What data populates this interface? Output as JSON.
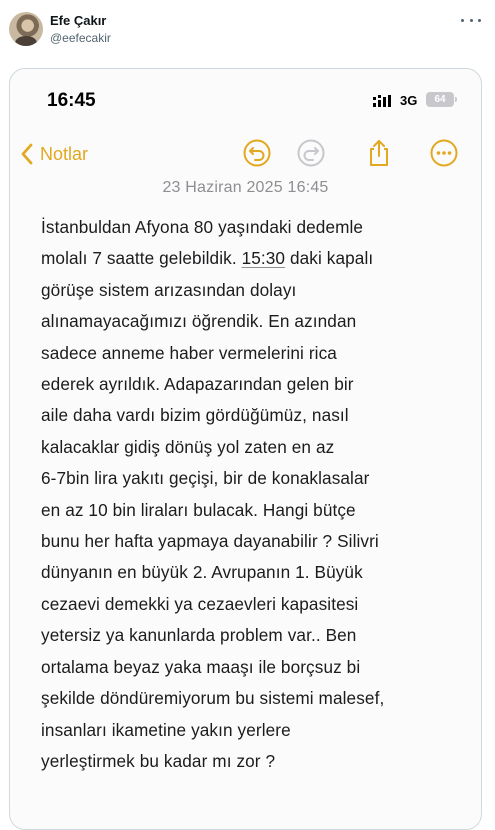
{
  "tweet": {
    "author_name": "Efe Çakır",
    "author_handle": "@eefecakir",
    "more_icon": "more-horizontal-icon"
  },
  "phone": {
    "status_bar": {
      "time": "16:45",
      "network": "3G",
      "battery": "64"
    },
    "notes_toolbar": {
      "back_label": "Notlar",
      "accent_color": "#e2a820",
      "icons": [
        "chevron-left-icon",
        "undo-icon",
        "redo-icon",
        "share-icon",
        "more-circle-icon"
      ]
    },
    "note": {
      "date": "23 Haziran 2025 16:45",
      "lines": [
        "İstanbuldan Afyona 80 yaşındaki dedemle",
        "molalı 7 saatte gelebildik. ",
        "görüşe sistem arızasından dolayı",
        "alınamayacağımızı öğrendik. En azından",
        "sadece anneme haber vermelerini rica",
        "ederek ayrıldık. Adapazarından gelen bir",
        "aile daha vardı bizim gördüğümüz, nasıl",
        "kalacaklar gidiş dönüş yol zaten en az",
        "6-7bin lira yakıtı geçişi, bir de konaklasalar",
        "en az 10 bin liraları bulacak. Hangi bütçe",
        "bunu her hafta yapmaya dayanabilir ? Silivri",
        "dünyanın en büyük 2. Avrupanın 1. Büyük",
        "cezaevi demekki ya cezaevleri kapasitesi",
        "yetersiz ya kanunlarda problem var.. Ben",
        "ortalama beyaz yaka maaşı ile borçsuz bi",
        "şekilde döndüremiyorum bu sistemi malesef,",
        "insanları ikametine yakın yerlere",
        "yerleştirmek bu kadar mı zor ?"
      ],
      "line2_time": "15:30",
      "line2_rest": " daki kapalı"
    }
  }
}
